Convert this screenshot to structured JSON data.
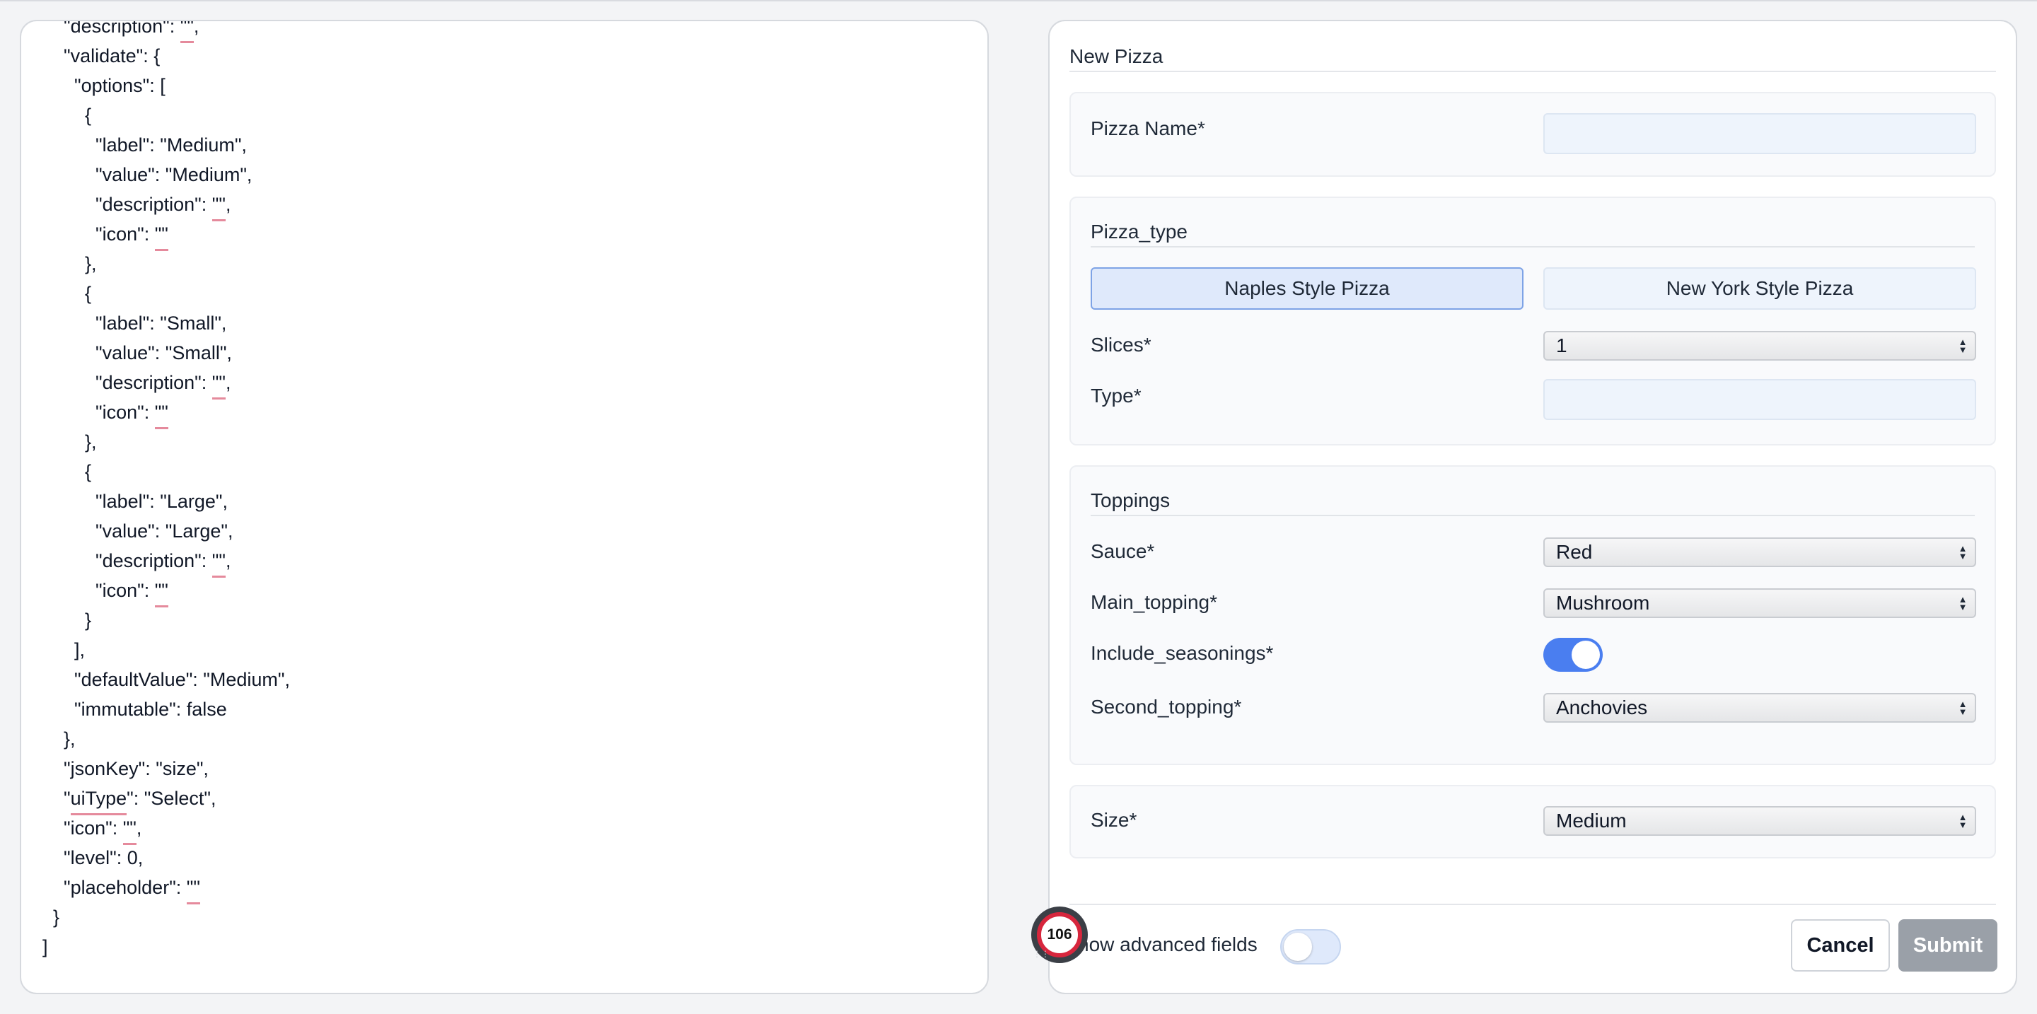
{
  "editor": {
    "lines": [
      "    \"description\": \"\",",
      "    \"validate\": {",
      "      \"options\": [",
      "        {",
      "          \"label\": \"Medium\",",
      "          \"value\": \"Medium\",",
      "          \"description\": \"\",",
      "          \"icon\": \"\"",
      "        },",
      "        {",
      "          \"label\": \"Small\",",
      "          \"value\": \"Small\",",
      "          \"description\": \"\",",
      "          \"icon\": \"\"",
      "        },",
      "        {",
      "          \"label\": \"Large\",",
      "          \"value\": \"Large\",",
      "          \"description\": \"\",",
      "          \"icon\": \"\"",
      "        }",
      "      ],",
      "      \"defaultValue\": \"Medium\",",
      "      \"immutable\": false",
      "    },",
      "    \"jsonKey\": \"size\",",
      "    \"uiType\": \"Select\",",
      "    \"icon\": \"\",",
      "    \"level\": 0,",
      "    \"placeholder\": \"\"",
      "  }",
      "]"
    ]
  },
  "form": {
    "title": "New Pizza",
    "pizza_name": {
      "label": "Pizza Name*",
      "value": ""
    },
    "pizza_type": {
      "section_title": "Pizza_type",
      "options": [
        "Naples Style Pizza",
        "New York Style Pizza"
      ],
      "selected": "Naples Style Pizza",
      "slices": {
        "label": "Slices*",
        "value": "1"
      },
      "type": {
        "label": "Type*",
        "value": ""
      }
    },
    "toppings": {
      "section_title": "Toppings",
      "sauce": {
        "label": "Sauce*",
        "value": "Red"
      },
      "main_topping": {
        "label": "Main_topping*",
        "value": "Mushroom"
      },
      "include_seasonings": {
        "label": "Include_seasonings*",
        "on": true
      },
      "second_topping": {
        "label": "Second_topping*",
        "value": "Anchovies"
      }
    },
    "size": {
      "label": "Size*",
      "value": "Medium"
    },
    "footer": {
      "advanced_label": "how advanced fields",
      "advanced_on": false,
      "cancel_label": "Cancel",
      "submit_label": "Submit"
    }
  },
  "badge": {
    "value": "106"
  },
  "colors": {
    "accent": "#4a7ef0",
    "squiggle": "#e58a9c",
    "badge_ring": "#d7263d"
  }
}
